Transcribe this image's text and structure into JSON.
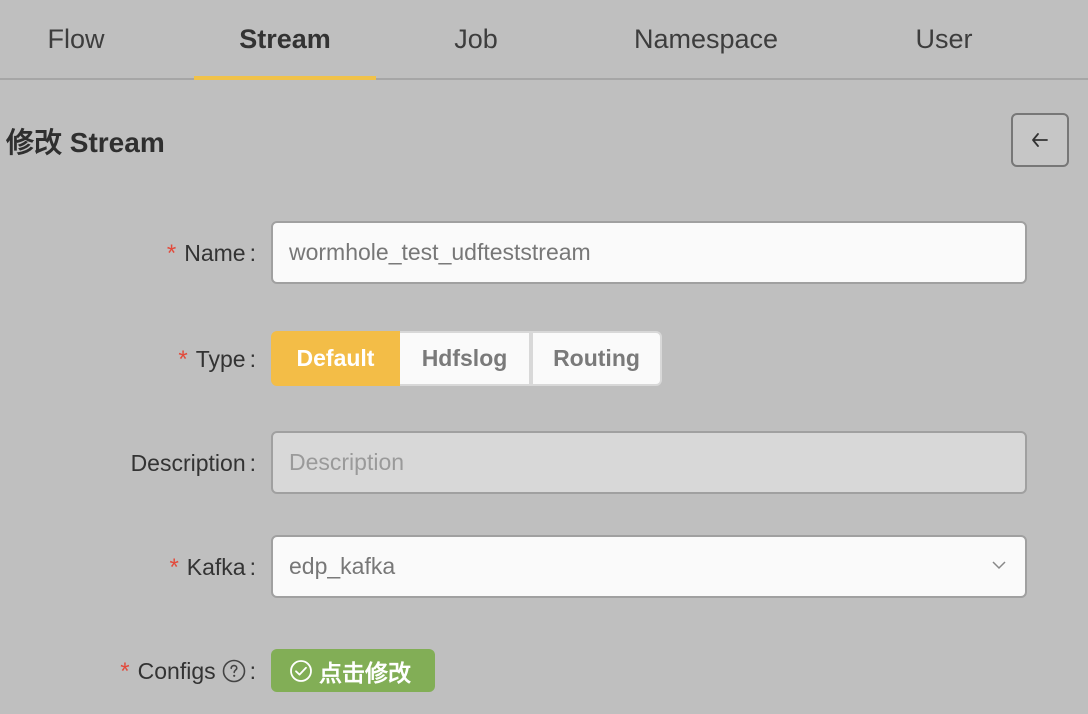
{
  "tabs": [
    {
      "label": "Flow",
      "active": false
    },
    {
      "label": "Stream",
      "active": true
    },
    {
      "label": "Job",
      "active": false
    },
    {
      "label": "Namespace",
      "active": false
    },
    {
      "label": "User",
      "active": false
    }
  ],
  "page_title": "修改 Stream",
  "back_button_icon": "arrow-left-icon",
  "form": {
    "name": {
      "label": "Name",
      "required": true,
      "value": "wormhole_test_udfteststream"
    },
    "type": {
      "label": "Type",
      "required": true,
      "options": [
        "Default",
        "Hdfslog",
        "Routing"
      ],
      "selected": "Default"
    },
    "description": {
      "label": "Description",
      "required": false,
      "placeholder": "Description",
      "disabled": true
    },
    "kafka": {
      "label": "Kafka",
      "required": true,
      "value": "edp_kafka"
    },
    "configs": {
      "label": "Configs",
      "required": true,
      "button_label": "点击修改"
    }
  },
  "colors": {
    "accent": "#f3bd47",
    "required": "#e34a3b",
    "success_button": "#82ae56"
  }
}
